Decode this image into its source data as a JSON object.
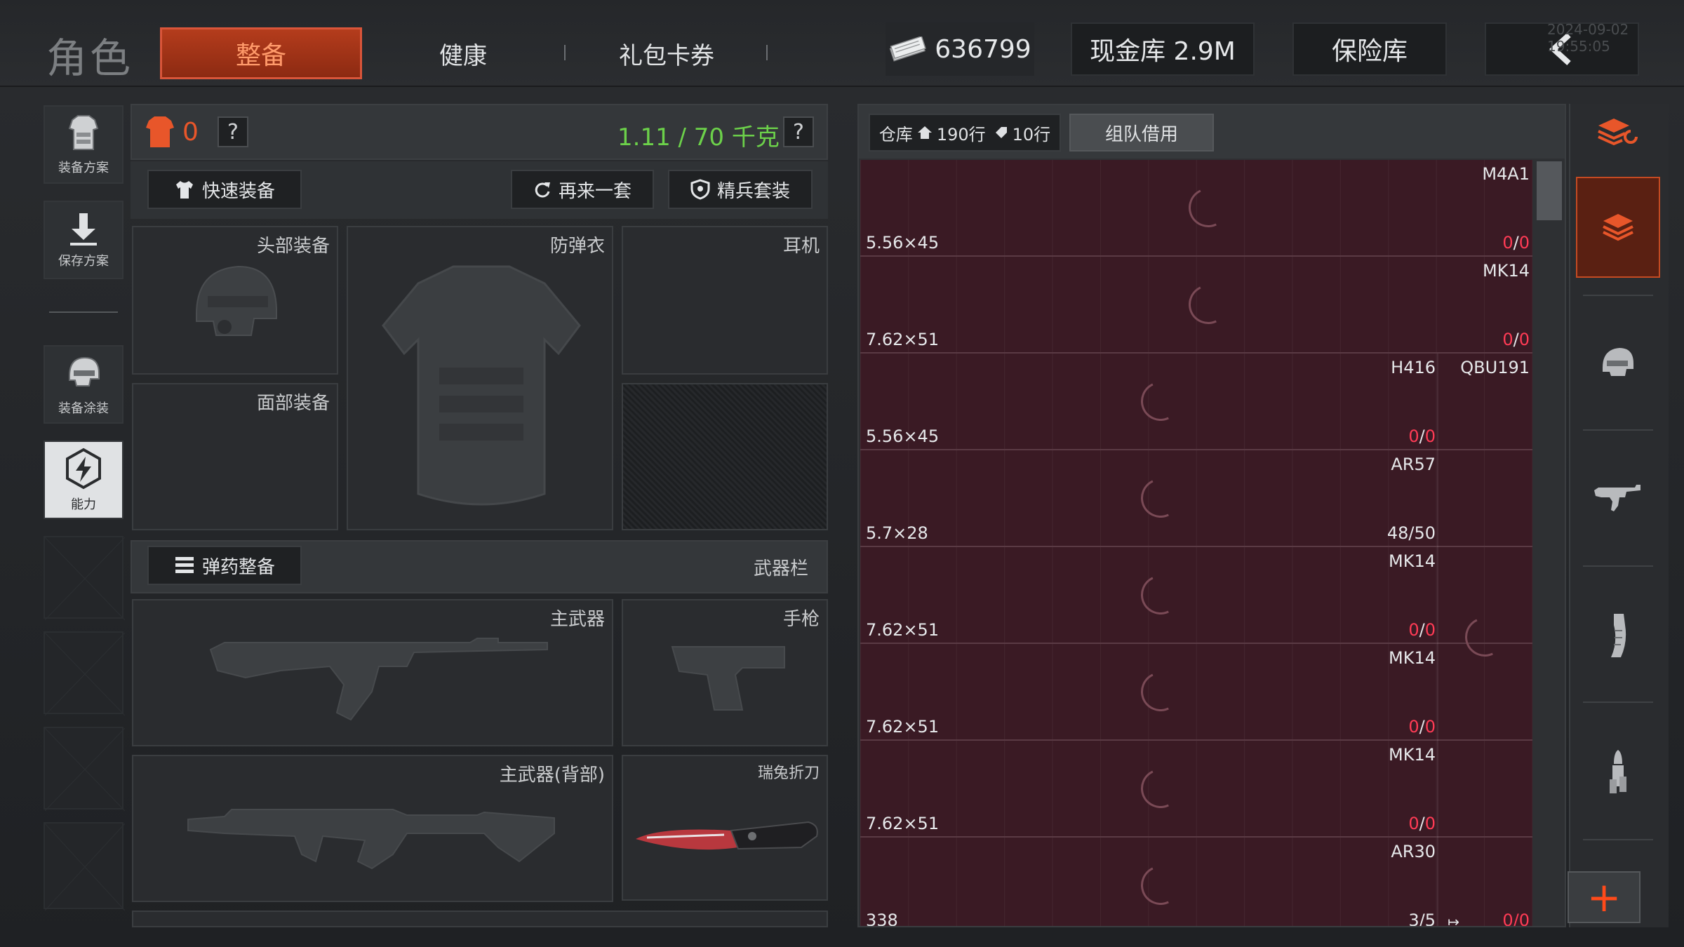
{
  "header": {
    "page_title": "角色",
    "tabs": [
      {
        "label": "整备",
        "active": true
      },
      {
        "label": "健康",
        "active": false
      },
      {
        "label": "礼包卡券",
        "active": false
      }
    ],
    "currency_value": "636799",
    "cash_vault": "现金库 2.9M",
    "safe_box": "保险库",
    "timestamp": "2024-09-02 19:55:05"
  },
  "sidebar": {
    "items": [
      {
        "label": "装备方案",
        "icon": "armor-plan-icon"
      },
      {
        "label": "保存方案",
        "icon": "download-icon"
      },
      {
        "label": "装备涂装",
        "icon": "helmet-skin-icon"
      },
      {
        "label": "能力",
        "icon": "ability-icon",
        "active": true
      }
    ]
  },
  "loadout": {
    "armor_level": "0",
    "help": "?",
    "weight": "1.11 / 70 千克",
    "quick_equip": "快速装备",
    "repeat_set": "再来一套",
    "elite_set": "精兵套装",
    "slots": {
      "head": "头部装备",
      "vest": "防弹衣",
      "headset": "耳机",
      "face": "面部装备"
    },
    "ammo_loadout": "弹药整备",
    "weapon_bar": "武器栏",
    "weapon_slots": {
      "primary": "主武器",
      "pistol": "手枪",
      "primary_back": "主武器(背部)",
      "knife": "瑞兔折刀"
    }
  },
  "warehouse": {
    "label": "仓库",
    "rows_home": "190行",
    "rows_tag": "10行",
    "team_borrow": "组队借用",
    "items": [
      {
        "ammo": "5.56×45",
        "weapon": "M4A1",
        "count_a": "0",
        "count_b": "0",
        "second_weapon": "",
        "a_red": true
      },
      {
        "ammo": "7.62×51",
        "weapon": "MK14",
        "count_a": "0",
        "count_b": "0",
        "second_weapon": "",
        "a_red": true
      },
      {
        "ammo": "5.56×45",
        "weapon": "H416",
        "count_a": "0",
        "count_b": "0",
        "second_weapon": "QBU191",
        "a_red": true
      },
      {
        "ammo": "5.7×28",
        "weapon": "AR57",
        "count_a": "48",
        "count_b": "50",
        "second_weapon": "",
        "a_red": false
      },
      {
        "ammo": "7.62×51",
        "weapon": "MK14",
        "count_a": "0",
        "count_b": "0",
        "second_weapon": "",
        "a_red": true
      },
      {
        "ammo": "7.62×51",
        "weapon": "MK14",
        "count_a": "0",
        "count_b": "0",
        "second_weapon": "",
        "a_red": true
      },
      {
        "ammo": "7.62×51",
        "weapon": "MK14",
        "count_a": "0",
        "count_b": "0",
        "second_weapon": "",
        "a_red": true
      },
      {
        "ammo": "338",
        "weapon": "AR30",
        "count_a": "3",
        "count_b": "5",
        "second_weapon": "",
        "a_red": false,
        "extra_count": "0/0"
      }
    ]
  },
  "right_column": {
    "icons": [
      "stack-refresh-icon",
      "stack-icon",
      "helmet-icon",
      "rifle-icon",
      "magazine-icon",
      "ammo-icon"
    ],
    "add": "+"
  },
  "colors": {
    "accent": "#b43c1c",
    "weight_green": "#6cd14a",
    "warning_red": "#ff3b55",
    "warehouse_bg": "#3a1a24"
  }
}
